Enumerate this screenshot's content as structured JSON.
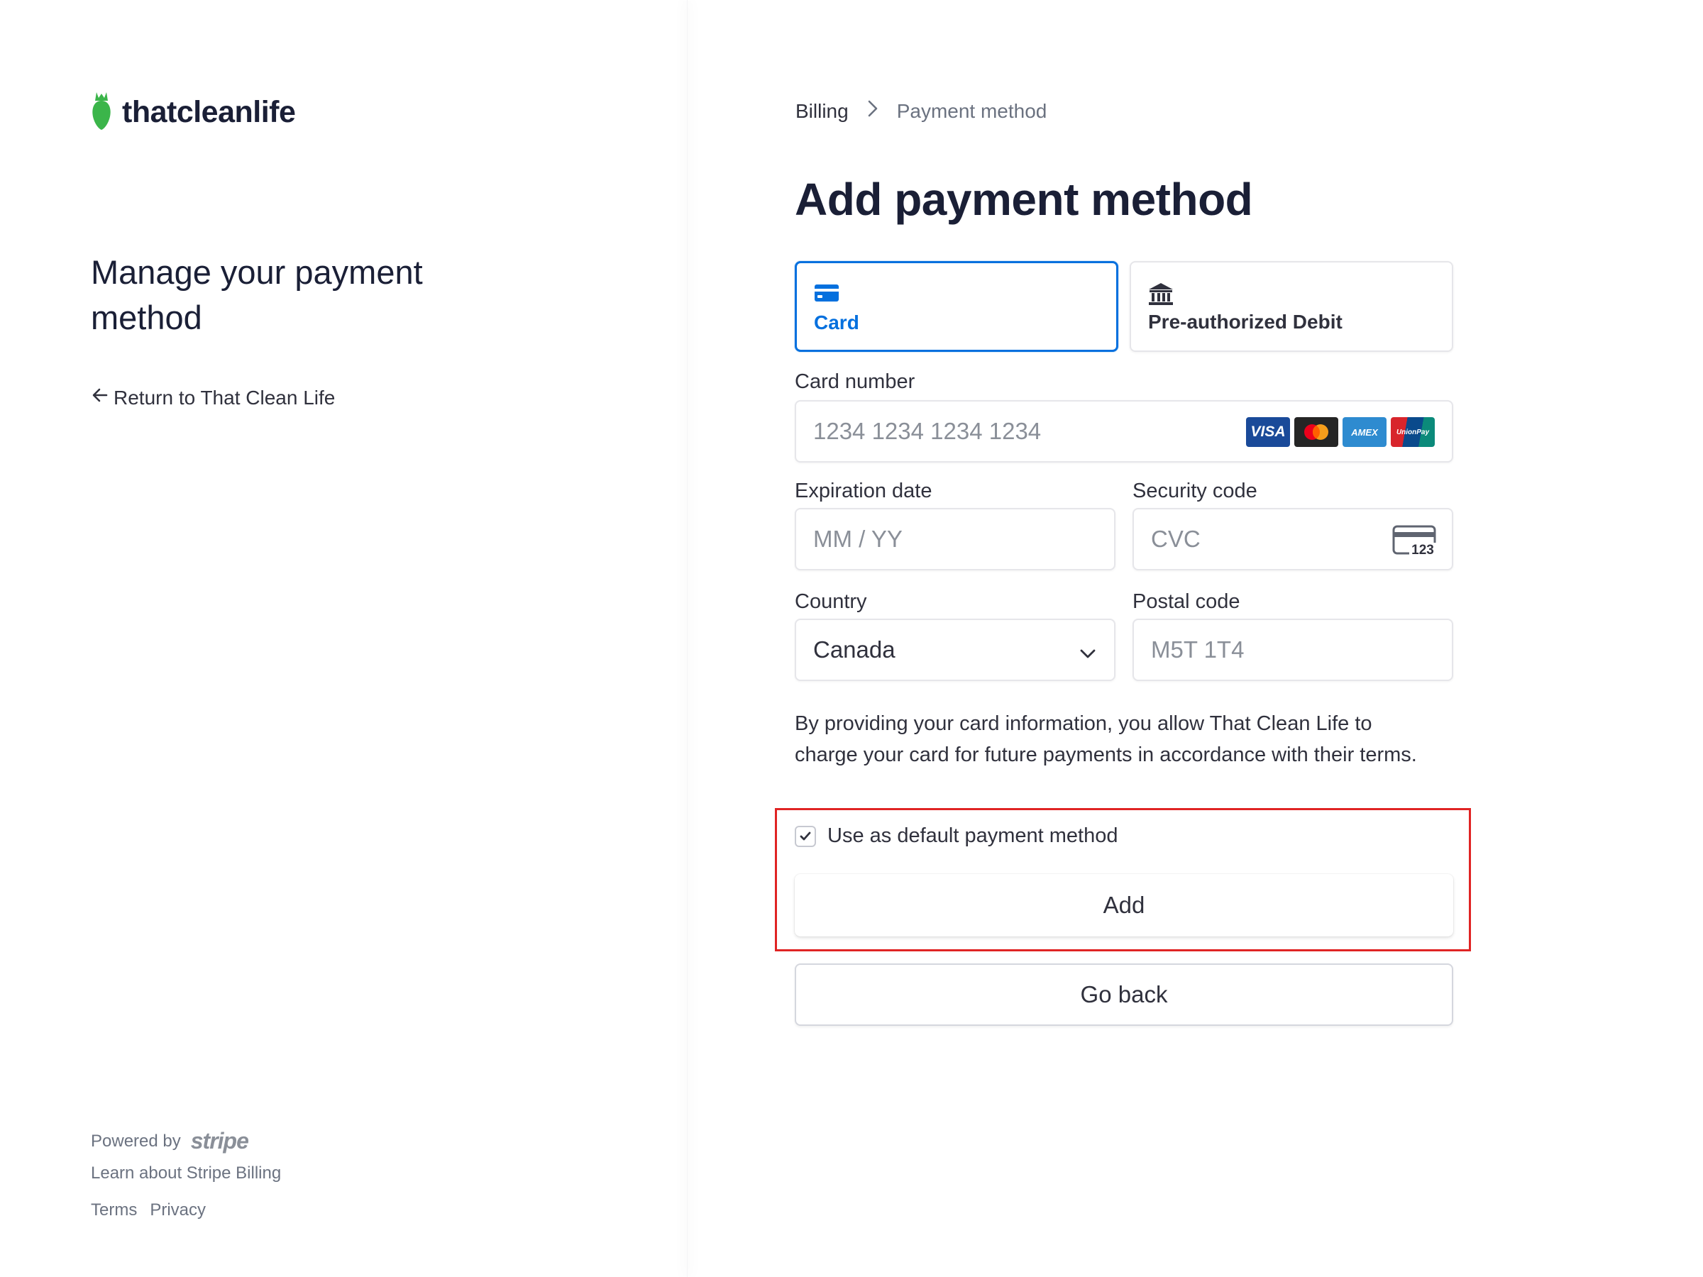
{
  "brand": {
    "logo_text": "thatcleanlife",
    "logo_color": "#3bb54a"
  },
  "left": {
    "title": "Manage your payment method",
    "return_link": "Return to That Clean Life",
    "powered_by": "Powered by",
    "stripe_word": "stripe",
    "learn_link": "Learn about Stripe Billing",
    "terms": "Terms",
    "privacy": "Privacy"
  },
  "breadcrumb": {
    "parent": "Billing",
    "current": "Payment method"
  },
  "page_title": "Add payment method",
  "tabs": [
    {
      "label": "Card",
      "icon": "card-icon",
      "selected": true
    },
    {
      "label": "Pre-authorized Debit",
      "icon": "bank-icon",
      "selected": false
    }
  ],
  "form": {
    "card_number_label": "Card number",
    "card_number_placeholder": "1234 1234 1234 1234",
    "card_brands": [
      "VISA",
      "Mastercard",
      "AMEX",
      "UnionPay"
    ],
    "expiry_label": "Expiration date",
    "expiry_placeholder": "MM / YY",
    "cvc_label": "Security code",
    "cvc_placeholder": "CVC",
    "cvc_icon_text": "123",
    "country_label": "Country",
    "country_value": "Canada",
    "postal_label": "Postal code",
    "postal_placeholder": "M5T 1T4"
  },
  "consent_text": "By providing your card information, you allow That Clean Life to charge your card for future payments in accordance with their terms.",
  "default_checkbox": {
    "label": "Use as default payment method",
    "checked": true
  },
  "buttons": {
    "add": "Add",
    "back": "Go back"
  },
  "colors": {
    "accent": "#0570de",
    "highlight": "#e02424",
    "text": "#30313d"
  }
}
